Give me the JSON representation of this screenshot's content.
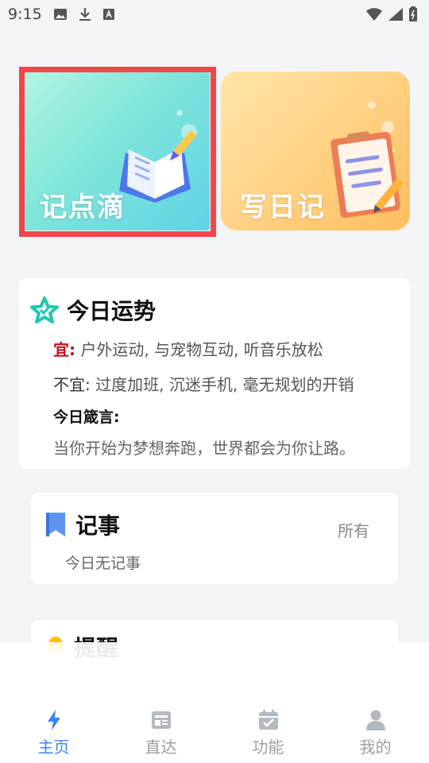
{
  "status_bar": {
    "time": "9:15",
    "icons": [
      "image-icon",
      "download-icon",
      "a-box-icon"
    ],
    "right_icons": [
      "wifi-icon",
      "signal-icon",
      "battery-icon"
    ]
  },
  "cards": [
    {
      "title": "记点滴",
      "icon": "open-book-pen-icon"
    },
    {
      "title": "写日记",
      "icon": "clipboard-pen-icon"
    }
  ],
  "fortune": {
    "title": "今日运势",
    "icon": "star-icon",
    "good_label": "宜:",
    "good_text": "户外运动, 与宠物互动, 听音乐放松",
    "bad_label": "不宜:",
    "bad_text": "过度加班, 沉迷手机, 毫无规划的开销",
    "motto_label": "今日箴言:",
    "motto_text": "当你开始为梦想奔跑，世界都会为你让路。"
  },
  "notes": {
    "title": "记事",
    "icon": "bookmark-icon",
    "all_label": "所有",
    "empty_text": "今日无记事"
  },
  "reminder": {
    "title": "提醒",
    "icon": "bell-icon"
  },
  "nav": [
    {
      "label": "主页",
      "icon": "lightning-icon",
      "active": true
    },
    {
      "label": "直达",
      "icon": "card-icon",
      "active": false
    },
    {
      "label": "功能",
      "icon": "calendar-check-icon",
      "active": false
    },
    {
      "label": "我的",
      "icon": "user-icon",
      "active": false
    }
  ],
  "colors": {
    "accent": "#3b82f6",
    "good": "#c0101a",
    "highlight_frame": "#f2464a"
  }
}
